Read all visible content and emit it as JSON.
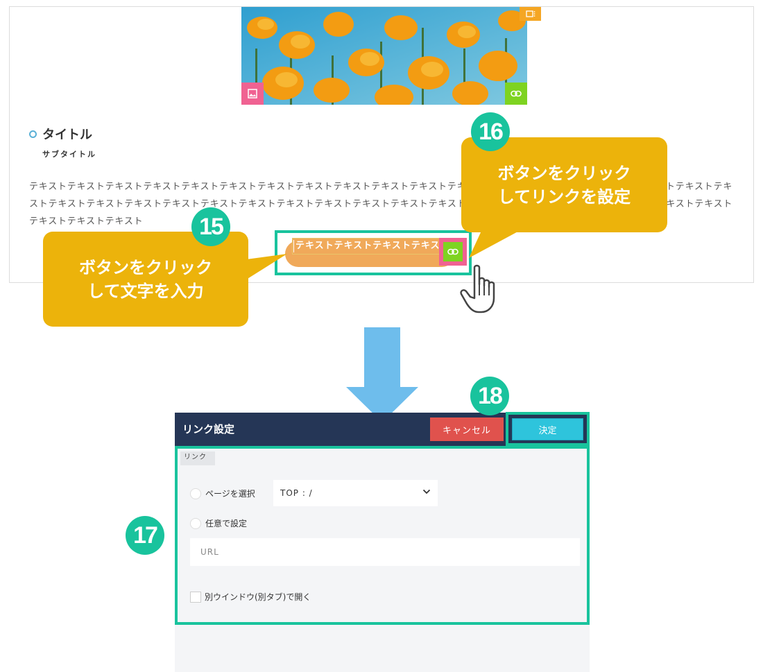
{
  "preview": {
    "title": "タイトル",
    "subtitle": "サブタイトル",
    "body_text": "テキストテキストテキストテキストテキストテキストテキストテキストテキストテキストテキストテキストテキストテキストテキストテキストテキストテキストテキストテキストテキストテキストテキストテキストテキストテキストテキストテキストテキストテキストテキストテキストテキストテキストテキストテキストテキストテキストテキストテキスト",
    "button_text": "テキストテキストテキストテキスト"
  },
  "callouts": {
    "c15": {
      "badge": "15",
      "line1": "ボタンをクリック",
      "line2": "して文字を入力"
    },
    "c16": {
      "badge": "16",
      "line1": "ボタンをクリック",
      "line2": "してリンクを設定"
    },
    "b17": "17",
    "b18": "18"
  },
  "dialog": {
    "title": "リンク設定",
    "cancel_label": "キャンセル",
    "ok_label": "決定",
    "tab_label": "リンク",
    "radio_page_label": "ページを選択",
    "select_value": "TOP : /",
    "radio_custom_label": "任意で設定",
    "url_placeholder": "URL",
    "new_window_label": "別ウインドウ(別タブ)で開く"
  },
  "colors": {
    "accent_green": "#19c39d",
    "callout_yellow": "#ecb30b",
    "header_navy": "#253656",
    "cancel_red": "#e0524d",
    "ok_cyan": "#2ec4dc",
    "arrow_blue": "#6ebdec"
  }
}
